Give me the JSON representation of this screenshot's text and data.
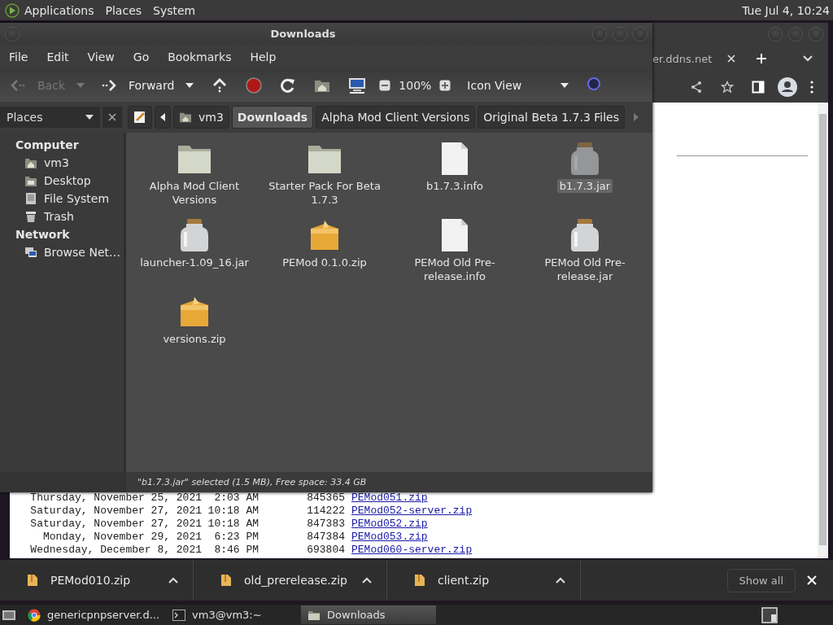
{
  "top_panel": {
    "menus": [
      "Applications",
      "Places",
      "System"
    ],
    "clock": "Tue Jul  4, 10:24"
  },
  "browser": {
    "tab_title": "er.ddns.net",
    "listing": [
      {
        "date": "Thursday, November 25, 2021",
        "time": "2:03 AM",
        "size": "845365",
        "link": "PEMod051.zip"
      },
      {
        "date": "Saturday, November 27, 2021",
        "time": "10:18 AM",
        "size": "114222",
        "link": "PEMod052-server.zip"
      },
      {
        "date": "Saturday, November 27, 2021",
        "time": "10:18 AM",
        "size": "847383",
        "link": "PEMod052.zip"
      },
      {
        "date": "Monday, November 29, 2021",
        "time": "6:23 PM",
        "size": "847384",
        "link": "PEMod053.zip"
      },
      {
        "date": "Wednesday, December 8, 2021",
        "time": "8:46 PM",
        "size": "693804",
        "link": "PEMod060-server.zip"
      }
    ]
  },
  "file_manager": {
    "title": "Downloads",
    "menu": [
      "File",
      "Edit",
      "View",
      "Go",
      "Bookmarks",
      "Help"
    ],
    "toolbar": {
      "back": {
        "label": "Back",
        "disabled": true
      },
      "forward": {
        "label": "Forward",
        "disabled": false
      },
      "zoom": "100%",
      "view": "Icon View"
    },
    "sidebar": {
      "title": "Places",
      "sections": [
        {
          "heading": "Computer",
          "items": [
            {
              "label": "vm3",
              "kind": "home"
            },
            {
              "label": "Desktop",
              "kind": "desktop"
            },
            {
              "label": "File System",
              "kind": "drive"
            },
            {
              "label": "Trash",
              "kind": "trash"
            }
          ]
        },
        {
          "heading": "Network",
          "items": [
            {
              "label": "Browse Net…",
              "kind": "network"
            }
          ]
        }
      ]
    },
    "breadcrumbs": [
      {
        "label": "vm3",
        "kind": "home",
        "selected": false
      },
      {
        "label": "Downloads",
        "kind": "plain",
        "selected": true
      },
      {
        "label": "Alpha Mod Client Versions",
        "kind": "plain",
        "selected": false
      },
      {
        "label": "Original Beta 1.7.3 Files",
        "kind": "plain",
        "selected": false
      }
    ],
    "files": [
      {
        "name": "Alpha Mod Client Versions",
        "kind": "folder",
        "selected": false
      },
      {
        "name": "Starter Pack For Beta 1.7.3",
        "kind": "folder",
        "selected": false
      },
      {
        "name": "b1.7.3.info",
        "kind": "document",
        "selected": false
      },
      {
        "name": "b1.7.3.jar",
        "kind": "jar",
        "selected": true
      },
      {
        "name": "launcher-1.09_16.jar",
        "kind": "jar",
        "selected": false
      },
      {
        "name": "PEMod 0.1.0.zip",
        "kind": "zip",
        "selected": false
      },
      {
        "name": "PEMod Old Pre-release.info",
        "kind": "document",
        "selected": false
      },
      {
        "name": "PEMod Old Pre-release.jar",
        "kind": "jar",
        "selected": false
      },
      {
        "name": "versions.zip",
        "kind": "zip",
        "selected": false
      }
    ],
    "status": "\"b1.7.3.jar\" selected (1.5 MB), Free space: 33.4 GB"
  },
  "downloads_bar": {
    "items": [
      "PEMod010.zip",
      "old_prerelease.zip",
      "client.zip"
    ],
    "show_all": "Show all"
  },
  "taskbar": {
    "items": [
      {
        "label": "genericpnpserver.d...",
        "kind": "browser",
        "selected": false
      },
      {
        "label": "vm3@vm3:~",
        "kind": "terminal",
        "selected": false
      },
      {
        "label": "Downloads",
        "kind": "folder",
        "selected": true
      }
    ]
  }
}
